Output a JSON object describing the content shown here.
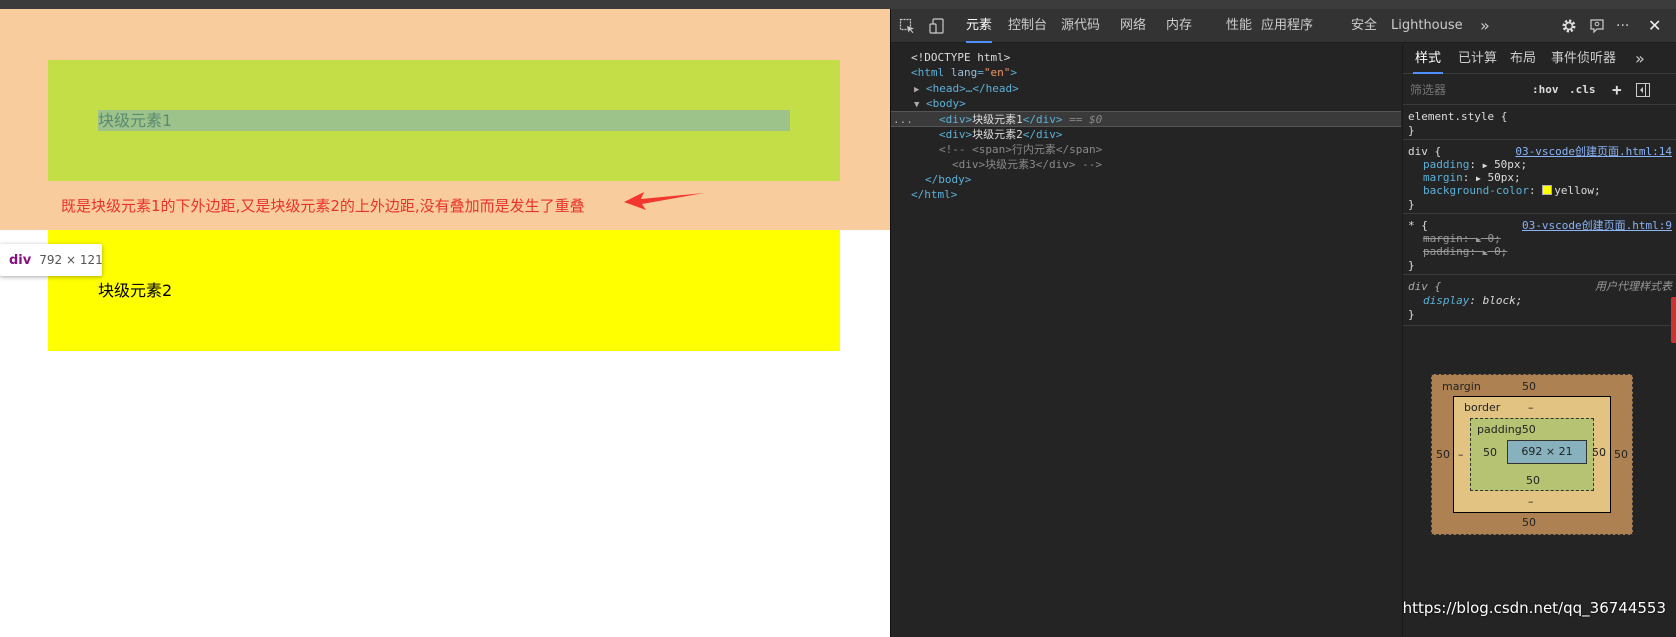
{
  "page": {
    "block1_text": "块级元素1",
    "block2_text": "块级元素2",
    "annotation": "既是块级元素1的下外边距,又是块级元素2的上外边距,没有叠加而是发生了重叠",
    "tooltip": {
      "tag": "div",
      "size": "792 × 121"
    }
  },
  "devtools": {
    "tabs": [
      "元素",
      "控制台",
      "源代码",
      "网络",
      "内存",
      "性能",
      "应用程序",
      "安全",
      "Lighthouse"
    ],
    "more_glyph": "»",
    "menu_glyph": "···",
    "close_glyph": "✕",
    "dom": {
      "doctype": "<!DOCTYPE html>",
      "html_open": "<html",
      "html_lang_attr": "lang",
      "html_lang_val": "\"en\"",
      "gt": ">",
      "head": "<head>…</head>",
      "body_open": "<body>",
      "div_open": "<div>",
      "div_close": "</div>",
      "div1_text": "块级元素1",
      "div2_text": "块级元素2",
      "selected_marker": "== $0",
      "ellipsis": "...",
      "comment1": "<!-- <span>行内元素</span>",
      "comment2": "<div>块级元素3</div> -->",
      "body_close": "</body>",
      "html_close": "</html>"
    },
    "styles": {
      "tabs": [
        "样式",
        "已计算",
        "布局",
        "事件侦听器"
      ],
      "more_glyph": "»",
      "filter_placeholder": "筛选器",
      "hov": ":hov",
      "cls": ".cls",
      "plus": "+",
      "element_style": "element.style {",
      "brace_close": "}",
      "rule_div_selector": "div {",
      "rule_div_source": "03-vscode创建页面.html:14",
      "padding_prop": "padding",
      "padding_val": "50px;",
      "margin_prop": "margin",
      "margin_val": "50px;",
      "bg_prop": "background-color",
      "bg_val": "yellow;",
      "rule_star_selector": "* {",
      "rule_star_source": "03-vscode创建页面.html:9",
      "star_margin_prop": "margin",
      "star_margin_val": "0;",
      "star_padding_prop": "padding",
      "star_padding_val": "0;",
      "ua_selector": "div {",
      "ua_label": "用户代理样式表",
      "display_prop": "display",
      "display_val": "block;",
      "colon": ":",
      "arrow_glyph": "▶"
    },
    "box_model": {
      "margin_label": "margin",
      "margin_top": "50",
      "margin_bottom": "50",
      "margin_left": "50",
      "margin_right": "50",
      "border_label": "border",
      "border_top": "–",
      "border_bottom": "–",
      "border_left": "–",
      "border_right": "–",
      "padding_label": "padding",
      "padding_top": "50",
      "padding_bottom": "50",
      "padding_left": "50",
      "padding_right": "50",
      "content": "692 × 21"
    }
  },
  "watermark": "https://blog.csdn.net/qq_36744553",
  "colors": {
    "margin_highlight": "#f9cc9d",
    "padding_highlight": "#c3de46",
    "content_highlight": "#9dc38a",
    "yellow": "#ffff00",
    "annotation_red": "#e8332a"
  }
}
